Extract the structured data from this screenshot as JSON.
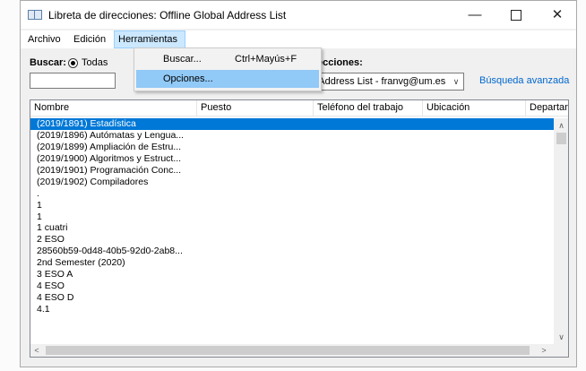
{
  "window": {
    "title": "Libreta de direcciones: Offline Global Address List",
    "controls": {
      "minimize": "—",
      "close": "✕"
    }
  },
  "menubar": {
    "items": [
      "Archivo",
      "Edición",
      "Herramientas"
    ]
  },
  "dropdown": {
    "items": [
      {
        "label": "Buscar...",
        "shortcut": "Ctrl+Mayús+F"
      },
      {
        "label": "Opciones...",
        "shortcut": ""
      }
    ]
  },
  "search": {
    "label": "Buscar:",
    "option_all": "Todas",
    "address_book_label": "direcciones:",
    "address_book_value": "obal Address List - franvg@um.es",
    "advanced_link": "Búsqueda avanzada"
  },
  "list": {
    "columns": [
      "Nombre",
      "Puesto",
      "Teléfono del trabajo",
      "Ubicación",
      "Departan"
    ],
    "rows": [
      "(2019/1891) Estadística",
      "(2019/1896) Autómatas y Lengua...",
      "(2019/1899) Ampliación de Estru...",
      "(2019/1900) Algoritmos y Estruct...",
      "(2019/1901) Programación Conc...",
      "(2019/1902) Compiladores",
      ".",
      "1",
      "1",
      "1 cuatri",
      "2 ESO",
      "28560b59-0d48-40b5-92d0-2ab8...",
      "2nd Semester (2020)",
      "3 ESO A",
      "4 ESO",
      "4 ESO D",
      "4.1"
    ],
    "selected_index": 0
  },
  "colors": {
    "selection": "#0078d7",
    "menu_highlight": "#91c9f7",
    "link": "#0066cc"
  }
}
